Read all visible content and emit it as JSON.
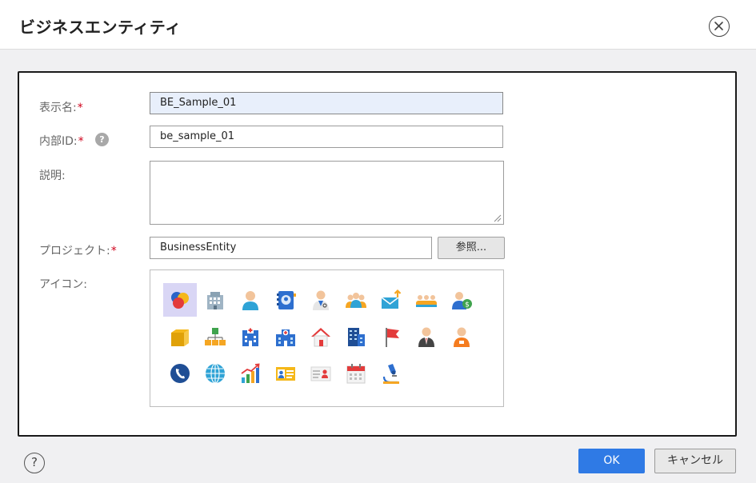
{
  "dialog": {
    "title": "ビジネスエンティティ"
  },
  "form": {
    "display_name": {
      "label": "表示名:",
      "required_mark": "*",
      "value": "BE_Sample_01"
    },
    "internal_id": {
      "label": "内部ID:",
      "required_mark": "*",
      "value": "be_sample_01",
      "help_icon": "?"
    },
    "description": {
      "label": "説明:",
      "value": ""
    },
    "project": {
      "label": "プロジェクト:",
      "required_mark": "*",
      "value": "BusinessEntity",
      "browse_label": "参照..."
    },
    "icon": {
      "label": "アイコン:"
    }
  },
  "icons": [
    {
      "name": "circles-icon",
      "selected": true
    },
    {
      "name": "office-building-icon"
    },
    {
      "name": "person-icon"
    },
    {
      "name": "address-book-icon"
    },
    {
      "name": "doctor-icon"
    },
    {
      "name": "group-icon"
    },
    {
      "name": "mail-upload-icon"
    },
    {
      "name": "team-icon"
    },
    {
      "name": "user-money-icon"
    },
    {
      "name": "folder-icon"
    },
    {
      "name": "hierarchy-icon"
    },
    {
      "name": "hospital-icon"
    },
    {
      "name": "clinic-icon"
    },
    {
      "name": "home-icon"
    },
    {
      "name": "skyscraper-icon"
    },
    {
      "name": "flag-icon"
    },
    {
      "name": "businessman-icon"
    },
    {
      "name": "worker-icon"
    },
    {
      "name": "phone-icon"
    },
    {
      "name": "globe-icon"
    },
    {
      "name": "chart-growth-icon"
    },
    {
      "name": "id-card-icon"
    },
    {
      "name": "contact-card-icon"
    },
    {
      "name": "calendar-icon"
    },
    {
      "name": "microscope-icon"
    }
  ],
  "footer": {
    "help_label": "?",
    "ok_label": "OK",
    "cancel_label": "キャンセル"
  },
  "colors": {
    "primary": "#2f7ae5",
    "required": "#d0021b",
    "selected_icon_bg": "#d9d6f5"
  }
}
